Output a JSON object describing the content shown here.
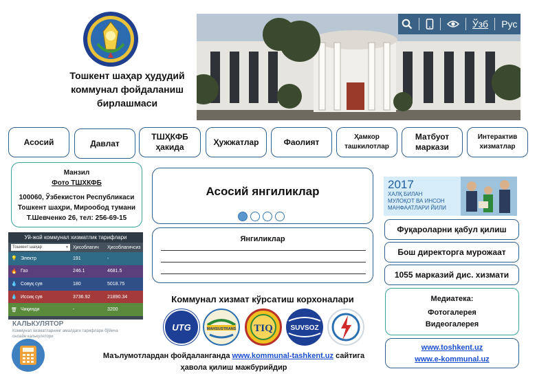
{
  "organization": {
    "title_line1": "Тошкент шаҳар ҳудудий",
    "title_line2": "коммунал фойдаланиш",
    "title_line3": "бирлашмаси",
    "emblem_text": "KUCH — ADOLATDA"
  },
  "topbar": {
    "icons": [
      "search-icon",
      "mobile-icon",
      "eye-icon"
    ],
    "lang_uz": "Ўзб",
    "lang_ru": "Рус"
  },
  "nav": [
    {
      "label": "Асосий"
    },
    {
      "label": "Давлат"
    },
    {
      "label": "ТШҲКФБ ҳакида"
    },
    {
      "label": "Ҳужжатлар"
    },
    {
      "label": "Фаолият"
    },
    {
      "label": "Ҳамкор ташкилотлар"
    },
    {
      "label": "Матбуот маркази"
    },
    {
      "label": "Интерактив хизматлар"
    }
  ],
  "address": {
    "title": "Манзил",
    "photo_link": "Фото ТШХКФБ",
    "line1": "100060, Ўзбекистон Республикаси",
    "line2": "Тошкент шаҳри, Мирообод тумани",
    "line3": "Т.Шевченко 26, тел: 256-69-15"
  },
  "tariff": {
    "title": "Уй-жой коммунал хизматлик тарифлари",
    "select_value": "Тошкент шаҳар",
    "col2": "Ҳисоблагич",
    "col3": "Ҳисоблагичсиз",
    "rows": [
      {
        "name": "Электр",
        "v1": "191",
        "v2": "-",
        "color": "#2f6b86",
        "icon": "lightbulb-icon"
      },
      {
        "name": "Газ",
        "v1": "246.1",
        "v2": "4681.5",
        "color": "#5b3f7d",
        "icon": "flame-icon"
      },
      {
        "name": "Совуқ сув",
        "v1": "180",
        "v2": "5018.75",
        "color": "#2f4f86",
        "icon": "drop-icon"
      },
      {
        "name": "Иссиқ сув",
        "v1": "3736.92",
        "v2": "21890.34",
        "color": "#a53a3a",
        "icon": "hot-drop-icon"
      },
      {
        "name": "Чиқинди",
        "v1": "-",
        "v2": "3200",
        "color": "#5a8a3c",
        "icon": "trash-icon"
      }
    ]
  },
  "calculator": {
    "title": "КАЛЬКУЛЯТОР",
    "subtitle": "Коммунал хизматларнинг амалдаги тарифлари бўйича онлайн калькулятори"
  },
  "news_main": {
    "title": "Асосий янгиликлар"
  },
  "news_list": {
    "title": "Янгиликлар"
  },
  "orgs": {
    "title": "Коммунал хизмат кўрсатиш корхоналари",
    "logos": [
      "UTG",
      "MAHSUSTRANS",
      "TIQ",
      "SUVSOZ",
      "Hududiy elektr"
    ]
  },
  "footer": {
    "prefix": "Маълумотлардан фойдаланганда ",
    "link": "www.kommunal-tashkent.uz",
    "suffix": " сайтига",
    "line2": "ҳавола қилиш мажбурийдир"
  },
  "banner": {
    "year": "2017",
    "line1": "ХАЛҚ БИЛАН",
    "line2": "МУЛОҚОТ ВА ИНСОН",
    "line3": "МАНФААТЛАРИ ЙИЛИ"
  },
  "right_buttons": [
    {
      "label": "Фуқароларни қабул қилиш"
    },
    {
      "label": "Бош директорга мурожаат"
    },
    {
      "label": "1055 марказий дис. хизмати"
    }
  ],
  "media": {
    "title": "Медиатека:",
    "item1": "Фотогалерея",
    "item2": "Видеогалерея"
  },
  "links": {
    "link1": "www.toshkent.uz",
    "link2": "www.e-kommunal.uz"
  }
}
